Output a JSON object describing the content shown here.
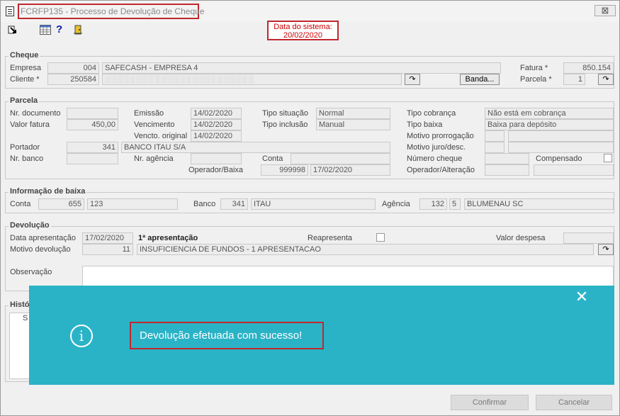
{
  "window": {
    "title": "FCRFP135 - Processo de Devolução de Cheque",
    "close_glyph": "⊠",
    "system_date_label": "Data do sistema:",
    "system_date": "20/02/2020"
  },
  "toolbar": {
    "icons": [
      "exit-arrow-icon",
      "grid-icon",
      "help-icon",
      "door-exit-icon"
    ],
    "help_glyph": "?"
  },
  "cheque": {
    "section_title": "Cheque",
    "empresa_label": "Empresa",
    "empresa_code": "004",
    "empresa_name": "SAFECASH -  EMPRESA 4",
    "cliente_label": "Cliente *",
    "cliente_code": "250584",
    "cliente_name": "░░░░░░░░░░░░░░░░░░░░░░░░",
    "lookup_glyph": "↷",
    "banda_button": "Banda...",
    "fatura_label": "Fatura *",
    "fatura_value": "850.154",
    "parcela_label": "Parcela *",
    "parcela_value": "1"
  },
  "parcela": {
    "section_title": "Parcela",
    "nr_documento_label": "Nr. documento",
    "nr_documento_value": "",
    "valor_fatura_label": "Valor fatura",
    "valor_fatura_value": "450,00",
    "emissao_label": "Emissão",
    "emissao_value": "14/02/2020",
    "vencimento_label": "Vencimento",
    "vencimento_value": "14/02/2020",
    "vencto_original_label": "Vencto. original",
    "vencto_original_value": "14/02/2020",
    "tipo_situacao_label": "Tipo situação",
    "tipo_situacao_value": "Normal",
    "tipo_inclusao_label": "Tipo inclusão",
    "tipo_inclusao_value": "Manual",
    "tipo_cobranca_label": "Tipo cobrança",
    "tipo_cobranca_value": "Não está em cobrança",
    "tipo_baixa_label": "Tipo baixa",
    "tipo_baixa_value": "Baixa para depósito",
    "motivo_prorrogacao_label": "Motivo prorrogação",
    "motivo_juro_label": "Motivo juro/desc.",
    "portador_label": "Portador",
    "portador_code": "341",
    "portador_name": "BANCO ITAU S/A",
    "nr_banco_label": "Nr. banco",
    "nr_agencia_label": "Nr. agência",
    "conta_label": "Conta",
    "numero_cheque_label": "Número cheque",
    "compensado_label": "Compensado",
    "operador_baixa_label": "Operador/Baixa",
    "operador_baixa_code": "999998",
    "operador_baixa_date": "17/02/2020",
    "operador_alteracao_label": "Operador/Alteração"
  },
  "baixa": {
    "section_title": "Informação de baixa",
    "conta_label": "Conta",
    "conta_code": "655",
    "conta_value": "123",
    "banco_label": "Banco",
    "banco_code": "341",
    "banco_name": "ITAU",
    "agencia_label": "Agência",
    "agencia_code": "132",
    "agencia_digit": "5",
    "agencia_name": "BLUMENAU SC"
  },
  "devolucao": {
    "section_title": "Devolução",
    "data_apresentacao_label": "Data apresentação",
    "data_apresentacao_value": "17/02/2020",
    "apresentacao_text": "1ª apresentação",
    "reapresenta_label": "Reapresenta",
    "valor_despesa_label": "Valor despesa",
    "motivo_label": "Motivo devolução",
    "motivo_code": "11",
    "motivo_text": "INSUFICIENCIA DE FUNDOS - 1 APRESENTACAO",
    "observacao_label": "Observação"
  },
  "historico": {
    "section_title": "Histó",
    "first_col": "S"
  },
  "modal": {
    "message": "Devolução efetuada com sucesso!",
    "close_glyph": "✕",
    "info_glyph": "i"
  },
  "actions": {
    "confirmar": "Confirmar",
    "cancelar": "Cancelar"
  }
}
